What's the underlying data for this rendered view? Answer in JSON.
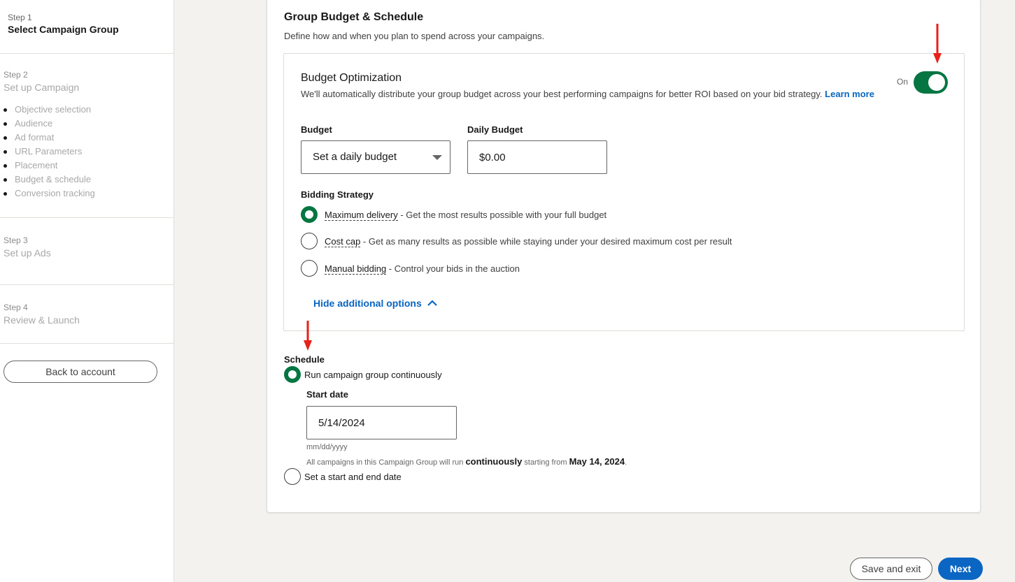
{
  "sidebar": {
    "steps": [
      {
        "num": "Step 1",
        "title": "Select Campaign Group",
        "state": "active"
      },
      {
        "num": "Step 2",
        "title": "Set up Campaign",
        "state": "inactive",
        "substeps": [
          "Objective selection",
          "Audience",
          "Ad format",
          "URL Parameters",
          "Placement",
          "Budget & schedule",
          "Conversion tracking"
        ]
      },
      {
        "num": "Step 3",
        "title": "Set up Ads",
        "state": "inactive"
      },
      {
        "num": "Step 4",
        "title": "Review & Launch",
        "state": "inactive"
      }
    ],
    "back_button": "Back to account"
  },
  "main": {
    "section_title": "Group Budget & Schedule",
    "section_desc": "Define how and when you plan to spend across your campaigns.",
    "budget_optimization": {
      "title": "Budget Optimization",
      "description": "We'll automatically distribute your group budget across your best performing campaigns for better ROI based on your bid strategy.",
      "learn_more": "Learn more",
      "toggle_label": "On",
      "toggle_state": true
    },
    "budget": {
      "label": "Budget",
      "selected": "Set a daily budget"
    },
    "daily_budget": {
      "label": "Daily Budget",
      "value": "$0.00"
    },
    "bidding": {
      "label": "Bidding Strategy",
      "options": [
        {
          "name": "Maximum delivery",
          "desc": " - Get the most results possible with your full budget",
          "checked": true
        },
        {
          "name": "Cost cap",
          "desc": " - Get as many results as possible while staying under your desired maximum cost per result",
          "checked": false
        },
        {
          "name": "Manual bidding",
          "desc": " - Control your bids in the auction",
          "checked": false
        }
      ],
      "hide_options": "Hide additional options"
    },
    "schedule": {
      "label": "Schedule",
      "continuous_label": "Run campaign group continuously",
      "start_date_label": "Start date",
      "start_date_value": "5/14/2024",
      "date_format_hint": "mm/dd/yyyy",
      "info_prefix": "All campaigns in this Campaign Group will run ",
      "info_bold1": "continuously",
      "info_mid": " starting from ",
      "info_bold2": "May 14, 2024",
      "info_suffix": ".",
      "start_end_label": "Set a start and end date"
    }
  },
  "footer": {
    "save_exit": "Save and exit",
    "next": "Next"
  },
  "colors": {
    "accent_green": "#057642",
    "link_blue": "#0a66c2",
    "annotation_red": "#e8201a"
  }
}
